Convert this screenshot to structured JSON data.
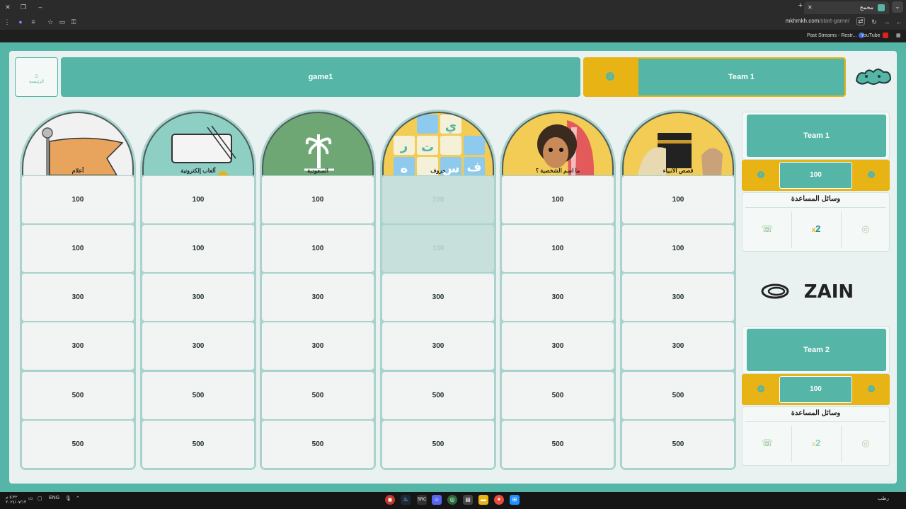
{
  "browser": {
    "tab_title": "مخمخ",
    "url_host": "mkhmkh.com",
    "url_path": "/start-game/",
    "bookmarks": [
      "Past Streams - Restr...",
      "YouTube"
    ]
  },
  "header": {
    "home_label": "الرئيسية",
    "game_name": "game1",
    "current_turn_team": "Team 1"
  },
  "categories": [
    {
      "name": "قصص الأنبياء",
      "cells": [
        "100",
        "100",
        "300",
        "300",
        "500",
        "500"
      ],
      "used": [
        false,
        false,
        false,
        false,
        false,
        false
      ]
    },
    {
      "name": "ما اسم الشخصية ؟",
      "cells": [
        "100",
        "100",
        "300",
        "300",
        "500",
        "500"
      ],
      "used": [
        false,
        false,
        false,
        false,
        false,
        false
      ]
    },
    {
      "name": "حروف",
      "cells": [
        "100",
        "100",
        "300",
        "300",
        "500",
        "500"
      ],
      "used": [
        true,
        true,
        false,
        false,
        false,
        false
      ]
    },
    {
      "name": "السعودية",
      "cells": [
        "100",
        "100",
        "300",
        "300",
        "500",
        "500"
      ],
      "used": [
        false,
        false,
        false,
        false,
        false,
        false
      ]
    },
    {
      "name": "ألعاب إلكترونية",
      "cells": [
        "100",
        "100",
        "300",
        "300",
        "500",
        "500"
      ],
      "used": [
        false,
        false,
        false,
        false,
        false,
        false
      ]
    },
    {
      "name": "أعلام",
      "cells": [
        "100",
        "100",
        "300",
        "300",
        "500",
        "500"
      ],
      "used": [
        false,
        false,
        false,
        false,
        false,
        false
      ]
    }
  ],
  "teams": [
    {
      "name": "Team 1",
      "score": "100",
      "aids_title": "وسائل المساعدة",
      "aids": [
        "call-icon",
        "2",
        "hole-icon"
      ]
    },
    {
      "name": "Team 2",
      "score": "100",
      "aids_title": "وسائل المساعدة",
      "aids": [
        "call-icon",
        "2",
        "hole-icon"
      ]
    }
  ],
  "sponsor": "ZAIN",
  "taskbar": {
    "language": "ENG",
    "clock_time": "٥:٣٢ م",
    "clock_date": "٢٠٢٤/٠٧/١٣",
    "weather": "رطب"
  },
  "colors": {
    "teal": "#55b5a6",
    "gold": "#e8b415",
    "board": "#eaf2f1"
  }
}
